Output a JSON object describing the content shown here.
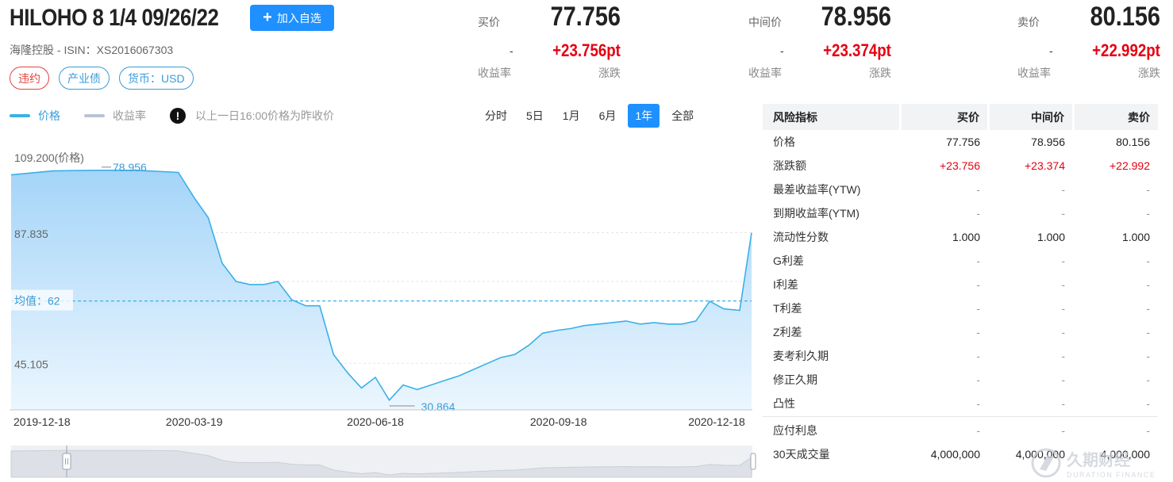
{
  "header": {
    "title": "HILOHO 8 1/4 09/26/22",
    "watch_button": "加入自选",
    "issuer_line": "海隆控股 - ISIN：XS2016067303",
    "tags": [
      {
        "label": "违约",
        "color": "#e3453d"
      },
      {
        "label": "产业债",
        "color": "#3a9bd8"
      },
      {
        "label": "货币：USD",
        "color": "#3a9bd8"
      }
    ]
  },
  "quotes": [
    {
      "label": "买价",
      "value": "77.756",
      "yield": "-",
      "change": "+23.756pt",
      "yield_label": "收益率",
      "change_label": "涨跌"
    },
    {
      "label": "中间价",
      "value": "78.956",
      "yield": "-",
      "change": "+23.374pt",
      "yield_label": "收益率",
      "change_label": "涨跌"
    },
    {
      "label": "卖价",
      "value": "80.156",
      "yield": "-",
      "change": "+22.992pt",
      "yield_label": "收益率",
      "change_label": "涨跌"
    }
  ],
  "legend": {
    "price": "价格",
    "yield": "收益率",
    "note": "以上一日16:00价格为昨收价"
  },
  "range_tabs": [
    "分时",
    "5日",
    "1月",
    "6月",
    "1年",
    "全部"
  ],
  "active_range": "1年",
  "chart_data": {
    "type": "area",
    "series": [
      {
        "name": "价格"
      }
    ],
    "x_dates": [
      "2019-12-18",
      "2020-01-08",
      "2020-01-29",
      "2020-02-19",
      "2020-03-11",
      "2020-03-19",
      "2020-03-26",
      "2020-04-02",
      "2020-04-09",
      "2020-04-16",
      "2020-04-23",
      "2020-04-30",
      "2020-05-07",
      "2020-05-14",
      "2020-05-21",
      "2020-05-28",
      "2020-06-04",
      "2020-06-11",
      "2020-06-18",
      "2020-06-25",
      "2020-07-02",
      "2020-07-09",
      "2020-07-16",
      "2020-07-23",
      "2020-07-30",
      "2020-08-06",
      "2020-08-13",
      "2020-08-20",
      "2020-08-27",
      "2020-09-03",
      "2020-09-10",
      "2020-09-18",
      "2020-09-24",
      "2020-10-01",
      "2020-10-08",
      "2020-10-15",
      "2020-10-22",
      "2020-10-29",
      "2020-11-05",
      "2020-11-12",
      "2020-11-19",
      "2020-11-26",
      "2020-12-03",
      "2020-12-10",
      "2020-12-18",
      "2020-12-24"
    ],
    "values": [
      107.0,
      108.3,
      108.5,
      108.5,
      107.8,
      99.5,
      93.0,
      78.0,
      72.0,
      71.0,
      71.0,
      72.0,
      66.0,
      64.0,
      64.0,
      48.0,
      42.0,
      37.0,
      40.5,
      33.0,
      38.0,
      36.5,
      38.0,
      39.5,
      41.0,
      43.0,
      45.0,
      47.0,
      48.0,
      51.0,
      55.0,
      56.0,
      56.5,
      57.5,
      58.0,
      58.5,
      59.0,
      58.0,
      58.5,
      58.0,
      58.0,
      59.0,
      65.5,
      63.0,
      62.5,
      88.0
    ],
    "y_ticks": [
      "109.200(价格)",
      "87.835",
      "45.105"
    ],
    "x_ticks": [
      "2019-12-18",
      "2020-03-19",
      "2020-06-18",
      "2020-09-18",
      "2020-12-18"
    ],
    "ylim": [
      30.864,
      109.2
    ],
    "mean_label": "均值：62",
    "mean_value": 65.6,
    "max_label": "78.956",
    "min_label": "30.864",
    "min_value": 30.864,
    "grid": "horizontal dashed",
    "line_color": "#3ab0e8",
    "fill_color": "#aad8fa"
  },
  "risk_table": {
    "headers": [
      "风险指标",
      "买价",
      "中间价",
      "卖价"
    ],
    "rows": [
      {
        "label": "价格",
        "values": [
          "77.756",
          "78.956",
          "80.156"
        ],
        "kind": "num"
      },
      {
        "label": "涨跌额",
        "values": [
          "+23.756",
          "+23.374",
          "+22.992"
        ],
        "kind": "up"
      },
      {
        "label": "最差收益率(YTW)",
        "values": [
          "-",
          "-",
          "-"
        ],
        "kind": "dash"
      },
      {
        "label": "到期收益率(YTM)",
        "values": [
          "-",
          "-",
          "-"
        ],
        "kind": "dash"
      },
      {
        "label": "流动性分数",
        "values": [
          "1.000",
          "1.000",
          "1.000"
        ],
        "kind": "num"
      },
      {
        "label": "G利差",
        "values": [
          "-",
          "-",
          "-"
        ],
        "kind": "dash"
      },
      {
        "label": "I利差",
        "values": [
          "-",
          "-",
          "-"
        ],
        "kind": "dash"
      },
      {
        "label": "T利差",
        "values": [
          "-",
          "-",
          "-"
        ],
        "kind": "dash"
      },
      {
        "label": "Z利差",
        "values": [
          "-",
          "-",
          "-"
        ],
        "kind": "dash"
      },
      {
        "label": "麦考利久期",
        "values": [
          "-",
          "-",
          "-"
        ],
        "kind": "dash"
      },
      {
        "label": "修正久期",
        "values": [
          "-",
          "-",
          "-"
        ],
        "kind": "dash"
      },
      {
        "label": "凸性",
        "values": [
          "-",
          "-",
          "-"
        ],
        "kind": "dash"
      }
    ],
    "rows2": [
      {
        "label": "应付利息",
        "values": [
          "-",
          "-",
          "-"
        ],
        "kind": "dash"
      },
      {
        "label": "30天成交量",
        "values": [
          "4,000,000",
          "4,000,000",
          "4,000,000"
        ],
        "kind": "num"
      }
    ]
  },
  "colors": {
    "accent": "#1e90ff",
    "up": "#e60012",
    "chart_line": "#3ab0e8"
  },
  "watermark": {
    "cn": "久期财经",
    "en": "DURATION FINANCE"
  }
}
